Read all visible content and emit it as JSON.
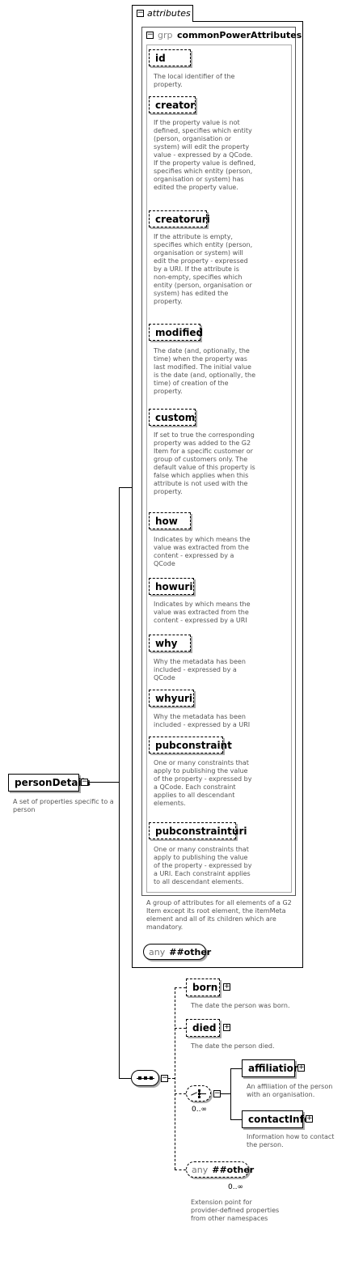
{
  "attributes": {
    "label": "attributes",
    "group": {
      "prefix": "grp",
      "name": "commonPowerAttributes",
      "items": [
        {
          "name": "id",
          "desc": [
            "The local identifier of the",
            "property."
          ]
        },
        {
          "name": "creator",
          "desc": [
            "If the property value is not",
            "defined, specifies which entity",
            "(person, organisation or",
            "system) will edit the property",
            "value - expressed by a QCode.",
            "If the property value is defined,",
            "specifies which entity (person,",
            "organisation or system) has",
            "edited the property value."
          ]
        },
        {
          "name": "creatoruri",
          "desc": [
            "If the attribute is empty,",
            "specifies which entity (person,",
            "organisation or system) will",
            "edit the property - expressed",
            "by a URI. If the attribute is",
            "non-empty, specifies which",
            "entity (person, organisation or",
            "system) has edited the",
            "property."
          ]
        },
        {
          "name": "modified",
          "desc": [
            "The date (and, optionally, the",
            "time) when the property was",
            "last modified. The initial value",
            "is the date (and, optionally, the",
            "time) of creation of the",
            "property."
          ]
        },
        {
          "name": "custom",
          "desc": [
            "If set to true the corresponding",
            "property was added to the G2",
            "Item for a specific customer or",
            "group of customers only. The",
            "default value of this property is",
            "false which applies when this",
            "attribute is not used with the",
            "property."
          ]
        },
        {
          "name": "how",
          "desc": [
            "Indicates by which means the",
            "value was extracted from the",
            "content - expressed by a",
            "QCode"
          ]
        },
        {
          "name": "howuri",
          "desc": [
            "Indicates by which means the",
            "value was extracted from the",
            "content - expressed by a URI"
          ]
        },
        {
          "name": "why",
          "desc": [
            "Why the metadata has been",
            "included - expressed by a",
            "QCode"
          ]
        },
        {
          "name": "whyuri",
          "desc": [
            "Why the metadata has been",
            "included - expressed by a URI"
          ]
        },
        {
          "name": "pubconstraint",
          "desc": [
            "One or many constraints that",
            "apply to publishing the value",
            "of the property - expressed by",
            "a QCode. Each constraint",
            "applies to all descendant",
            "elements."
          ]
        },
        {
          "name": "pubconstrainturi",
          "desc": [
            "One or many constraints that",
            "apply to publishing the value",
            "of the property - expressed by",
            "a URI. Each constraint applies",
            "to all descendant elements."
          ]
        }
      ],
      "desc": [
        "A group of attributes for all elements of a G2",
        "Item except its root element, the itemMeta",
        "element and all of its children which are",
        "mandatory."
      ]
    },
    "any": {
      "prefix": "any",
      "name": "##other"
    }
  },
  "root": {
    "name": "personDetails",
    "desc": [
      "A set of properties specific to a",
      "person"
    ]
  },
  "children": {
    "born": {
      "name": "born",
      "desc": [
        "The date the person was born."
      ]
    },
    "died": {
      "name": "died",
      "desc": [
        "The date the person died."
      ]
    },
    "choice_occurrence": "0..∞",
    "affiliation": {
      "name": "affiliation",
      "desc": [
        "An affiliation of the person",
        "with an organisation."
      ]
    },
    "contactInfo": {
      "name": "contactInfo",
      "desc": [
        "Information how to contact",
        "the person."
      ]
    },
    "any": {
      "prefix": "any",
      "name": "##other",
      "occurrence": "0..∞",
      "desc": [
        "Extension point for",
        "provider-defined properties",
        "from other namespaces"
      ]
    }
  }
}
